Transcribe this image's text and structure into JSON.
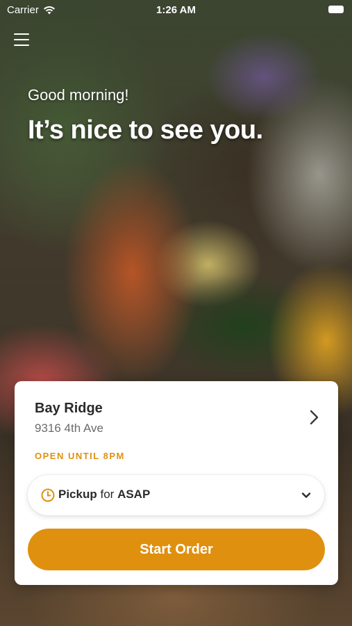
{
  "status_bar": {
    "carrier": "Carrier",
    "time": "1:26 AM",
    "wifi_icon": "wifi-icon",
    "battery_icon": "battery-icon"
  },
  "header": {
    "menu_icon": "hamburger-menu-icon",
    "greeting": "Good morning!",
    "headline": "It’s nice to see you."
  },
  "location_card": {
    "store_name": "Bay Ridge",
    "store_address": "9316 4th Ave",
    "open_status": "OPEN UNTIL 8PM",
    "chevron_icon": "chevron-right-icon",
    "order_mode": {
      "icon": "clock-icon",
      "mode": "Pickup",
      "connector": "for",
      "time": "ASAP",
      "dropdown_icon": "chevron-down-icon"
    },
    "start_button_label": "Start Order"
  },
  "colors": {
    "accent": "#E0900F",
    "card_background": "#FFFFFF",
    "primary_text": "#2A2A2A",
    "secondary_text": "#6B6B6B"
  }
}
